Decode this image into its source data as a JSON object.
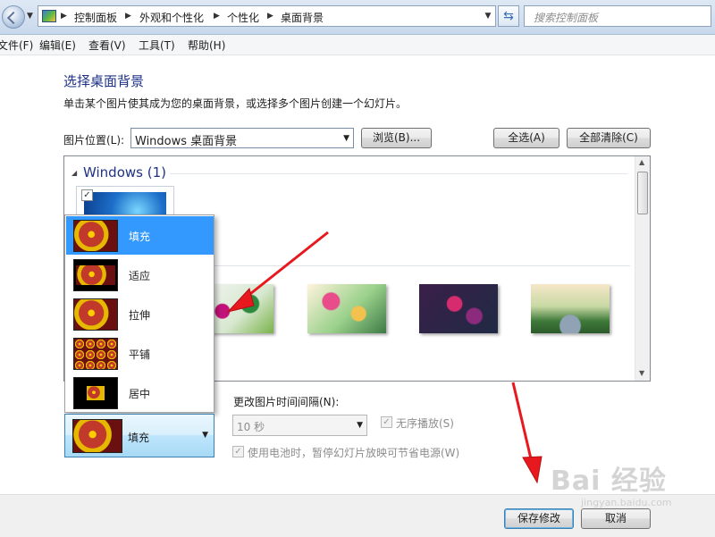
{
  "address_bar": {
    "breadcrumbs": [
      "控制面板",
      "外观和个性化",
      "个性化",
      "桌面背景"
    ],
    "search_placeholder": "搜索控制面板"
  },
  "menu": [
    "文件(F)",
    "编辑(E)",
    "查看(V)",
    "工具(T)",
    "帮助(H)"
  ],
  "page": {
    "title": "选择桌面背景",
    "description": "单击某个图片使其成为您的桌面背景，或选择多个图片创建一个幻灯片。"
  },
  "location": {
    "label": "图片位置(L):",
    "selected": "Windows 桌面背景",
    "browse_button": "浏览(B)...",
    "select_all_button": "全选(A)",
    "clear_all_button": "全部清除(C)"
  },
  "gallery": {
    "group_title": "Windows (1)",
    "windows_thumb_checked": true
  },
  "position_menu": {
    "options": [
      "填充",
      "适应",
      "拉伸",
      "平铺",
      "居中"
    ],
    "selected": "填充"
  },
  "slideshow": {
    "interval_label": "更改图片时间间隔(N):",
    "interval_value": "10 秒",
    "shuffle_label": "无序播放(S)",
    "shuffle_checked": true,
    "battery_label": "使用电池时，暂停幻灯片放映可节省电源(W)",
    "battery_checked": true
  },
  "footer": {
    "save_button": "保存修改",
    "cancel_button": "取消"
  },
  "watermark": {
    "text": "Bai 经验",
    "subtext": "jingyan.baidu.com"
  },
  "colors": {
    "title_blue": "#1e3287",
    "selection_blue": "#3399ff",
    "arrow_red": "#e8191e"
  }
}
